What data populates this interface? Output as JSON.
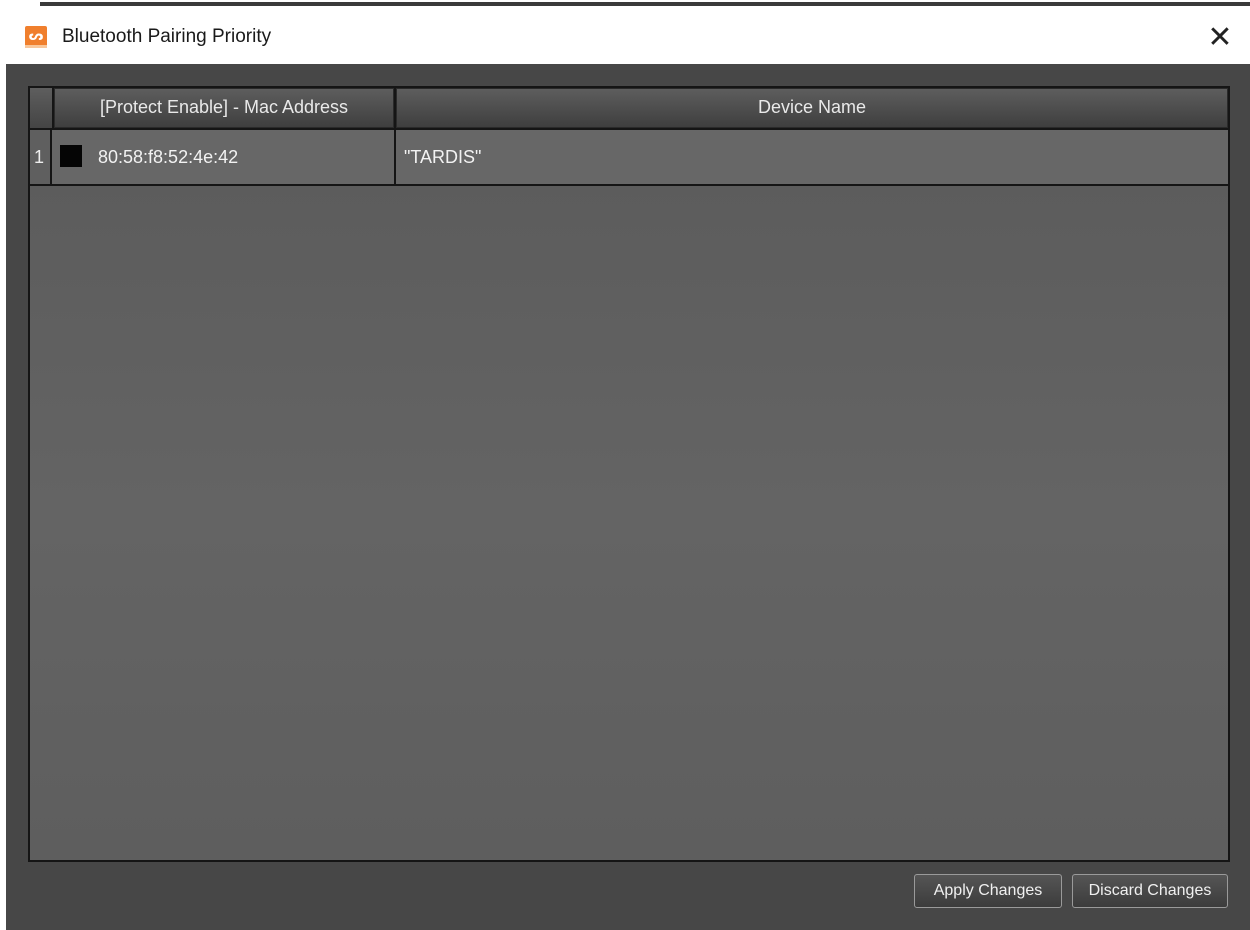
{
  "window": {
    "title": "Bluetooth Pairing Priority",
    "app_icon_glyph": "ᔕ",
    "close_glyph": "✕",
    "accent_color": "#f07f2d"
  },
  "table": {
    "columns": [
      "[Protect Enable] -  Mac Address",
      "Device Name"
    ],
    "rows": [
      {
        "index": "1",
        "protect_enabled": true,
        "mac": "80:58:f8:52:4e:42",
        "device_name": "\"TARDIS\""
      }
    ]
  },
  "buttons": {
    "apply": "Apply Changes",
    "discard": "Discard Changes"
  }
}
